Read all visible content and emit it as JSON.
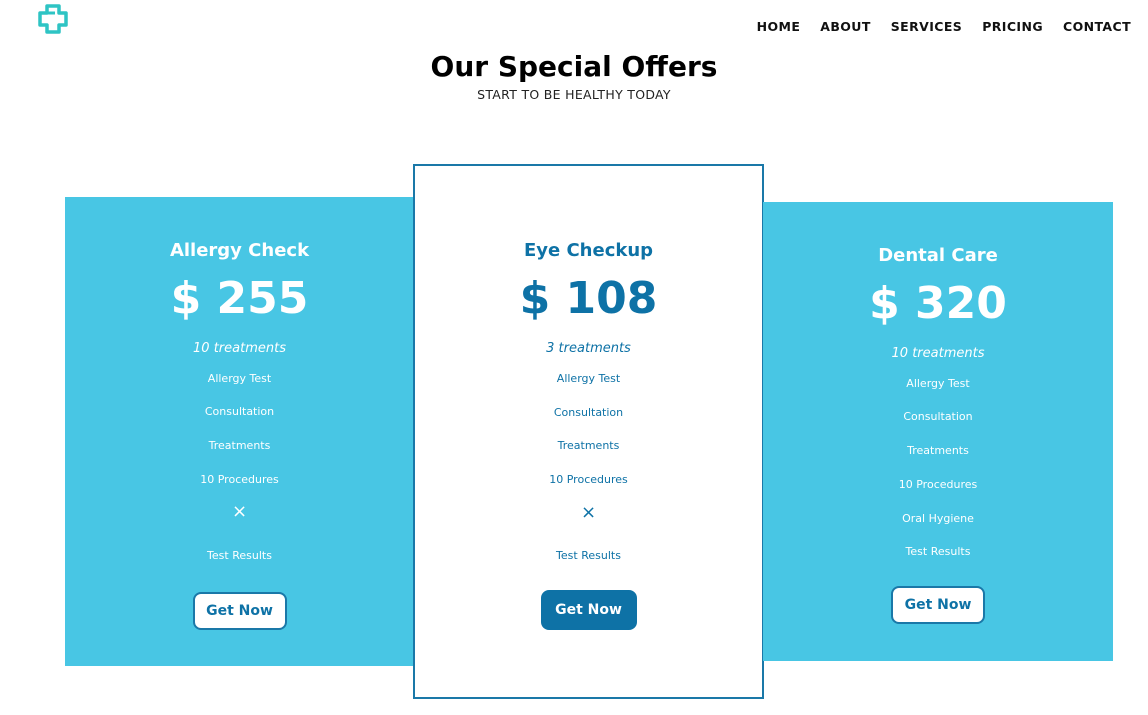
{
  "nav": {
    "items": [
      "HOME",
      "ABOUT",
      "SERVICES",
      "PRICING",
      "CONTACT"
    ]
  },
  "hero": {
    "title": "Our Special Offers",
    "subtitle": "START TO BE HEALTHY TODAY"
  },
  "colors": {
    "accent_blue": "#48c6e4",
    "dark_blue": "#0e72a6",
    "logo_teal": "#2ec4c4"
  },
  "plans": [
    {
      "name": "Allergy Check",
      "price": "$ 255",
      "treatments": "10 treatments",
      "features": [
        "Allergy Test",
        "Consultation",
        "Treatments",
        "10 Procedures"
      ],
      "excluded_icon": "×",
      "last_feature": "Test Results",
      "cta": "Get Now"
    },
    {
      "name": "Eye Checkup",
      "price": "$ 108",
      "treatments": "3 treatments",
      "features": [
        "Allergy Test",
        "Consultation",
        "Treatments",
        "10 Procedures"
      ],
      "excluded_icon": "×",
      "last_feature": "Test Results",
      "cta": "Get Now"
    },
    {
      "name": "Dental Care",
      "price": "$ 320",
      "treatments": "10 treatments",
      "features": [
        "Allergy Test",
        "Consultation",
        "Treatments",
        "10 Procedures",
        "Oral Hygiene"
      ],
      "last_feature": "Test Results",
      "cta": "Get Now"
    }
  ]
}
